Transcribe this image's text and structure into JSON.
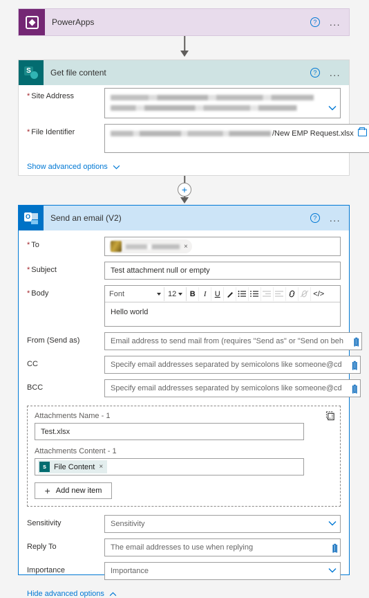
{
  "flow": {
    "trigger": {
      "title": "PowerApps",
      "icon": "powerapps-icon",
      "header_color": "#E8DCEC",
      "icon_color": "#742774",
      "help_label": "?",
      "menu_label": "..."
    },
    "action_sharepoint": {
      "title": "Get file content",
      "icon": "sharepoint-icon",
      "header_color": "#CFE3E3",
      "icon_color": "#036C70",
      "help_label": "?",
      "menu_label": "...",
      "fields": [
        {
          "label": "Site Address",
          "required": true,
          "type": "combobox",
          "value": "",
          "redacted": true
        },
        {
          "label": "File Identifier",
          "required": true,
          "type": "picker",
          "value": "/New EMP Request.xlsx",
          "redacted": true
        }
      ],
      "advanced_link": "Show advanced options"
    },
    "action_outlook": {
      "title": "Send an email (V2)",
      "icon": "outlook-icon",
      "header_color": "#CCE4F7",
      "icon_color": "#0072C6",
      "selected_border": "#0078D4",
      "help_label": "?",
      "menu_label": "...",
      "to": {
        "label": "To",
        "required": true,
        "chip_remove": "×"
      },
      "subject": {
        "label": "Subject",
        "required": true,
        "value": "Test attachment null or empty"
      },
      "body": {
        "label": "Body",
        "required": true,
        "value": "Hello world",
        "toolbar": {
          "font_name": "Font",
          "font_size": "12",
          "bold": "B",
          "italic": "I",
          "underline": "U",
          "text_color": "✎",
          "numbered_list": "☰",
          "bulleted_list": "☰",
          "indent": "→",
          "outdent": "←",
          "link": "⚭",
          "unlink": "⚭",
          "code_view": "</>"
        }
      },
      "from": {
        "label": "From (Send as)",
        "placeholder": "Email address to send mail from (requires \"Send as\" or \"Send on beh"
      },
      "cc": {
        "label": "CC",
        "placeholder": "Specify email addresses separated by semicolons like someone@cd"
      },
      "bcc": {
        "label": "BCC",
        "placeholder": "Specify email addresses separated by semicolons like someone@cd"
      },
      "attachments": {
        "name_label": "Attachments Name - 1",
        "name_value": "Test.xlsx",
        "content_label": "Attachments Content - 1",
        "token_label": "File Content",
        "token_remove": "×",
        "add_item_label": "Add new item",
        "add_item_icon": "plus-icon",
        "delete_icon": "delete-icon"
      },
      "sensitivity": {
        "label": "Sensitivity",
        "placeholder": "Sensitivity"
      },
      "reply_to": {
        "label": "Reply To",
        "placeholder": "The email addresses to use when replying"
      },
      "importance": {
        "label": "Importance",
        "placeholder": "Importance"
      },
      "advanced_link": "Hide advanced options"
    },
    "insert_button": "+"
  }
}
